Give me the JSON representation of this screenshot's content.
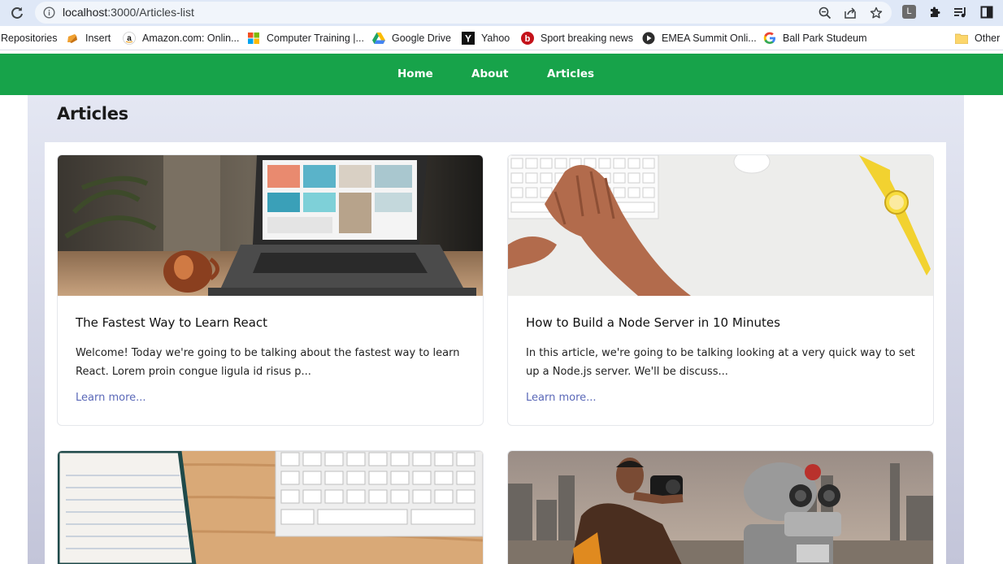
{
  "browser": {
    "url_host": "localhost",
    "url_path": ":3000/Articles-list",
    "profile_initial": "L",
    "icons": [
      "reload-icon",
      "site-info-icon",
      "zoom-icon",
      "share-icon",
      "bookmark-star-icon",
      "extensions-puzzle-icon",
      "reading-list-icon",
      "side-panel-icon"
    ]
  },
  "bookmarks": {
    "items": [
      {
        "label": "Repositories",
        "icon": "none"
      },
      {
        "label": "Insert",
        "icon": "insert-folder-icon"
      },
      {
        "label": "Amazon.com: Onlin...",
        "icon": "amazon-icon"
      },
      {
        "label": "Computer Training |...",
        "icon": "microsoft-icon"
      },
      {
        "label": "Google Drive",
        "icon": "google-drive-icon"
      },
      {
        "label": "Yahoo",
        "icon": "yahoo-icon"
      },
      {
        "label": "Sport breaking news",
        "icon": "b-icon"
      },
      {
        "label": "EMEA Summit Onli...",
        "icon": "play-icon"
      },
      {
        "label": "Ball Park Studeum",
        "icon": "google-icon"
      }
    ],
    "overflow": "»",
    "other_label": "Other b"
  },
  "nav": {
    "links": [
      "Home",
      "About",
      "Articles"
    ]
  },
  "page": {
    "title": "Articles"
  },
  "articles": [
    {
      "title": "The Fastest Way to Learn React",
      "excerpt": "Welcome! Today we're going to be talking about the fastest way to learn React. Lorem proin congue ligula id risus p...",
      "link": "Learn more..."
    },
    {
      "title": "How to Build a Node Server in 10 Minutes",
      "excerpt": "In this article, we're going to be talking looking at a very quick way to set up a Node.js server. We'll be discuss...",
      "link": "Learn more..."
    }
  ],
  "colors": {
    "nav_green": "#17a34a",
    "link_blue": "#5a68b8",
    "panel_top": "#e4e7f3",
    "panel_bottom": "#c3c5d9"
  }
}
